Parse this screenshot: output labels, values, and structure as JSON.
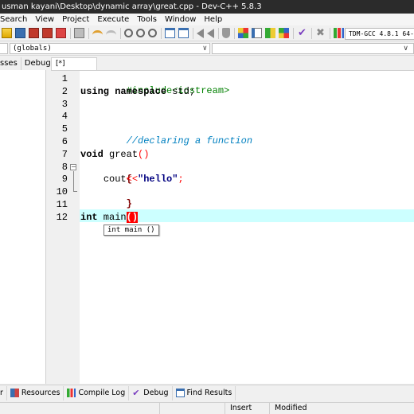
{
  "window": {
    "title": "usman kayani\\Desktop\\dynamic array\\great.cpp - Dev-C++ 5.8.3"
  },
  "menu": {
    "items": [
      "Search",
      "View",
      "Project",
      "Execute",
      "Tools",
      "Window",
      "Help"
    ]
  },
  "toolbar": {
    "compiler": "TDM-GCC 4.8.1 64-"
  },
  "scope": {
    "value": "(globals)"
  },
  "left_panel": {
    "tabs": [
      "sses",
      "Debug"
    ]
  },
  "editor": {
    "tab_label": "[*] great.cpp",
    "line_numbers": [
      "1",
      "2",
      "3",
      "4",
      "5",
      "6",
      "7",
      "8",
      "9",
      "10",
      "11",
      "12"
    ],
    "code": {
      "l1": "#include<iostream>",
      "l2_kw": "using namespace",
      "l2_rest": " std;",
      "l5": "//declaring a function",
      "l7_kw": "void",
      "l7_name": " great",
      "l7_paren": "()",
      "l8": "{",
      "l9_indent": "    ",
      "l9_id": "cout",
      "l9_op": "<<",
      "l9_str": "\"hello\"",
      "l9_end": ";",
      "l10": "}",
      "l12_kw": "int",
      "l12_name": " main",
      "l12_paren": "()"
    },
    "tooltip": "int main ()"
  },
  "bottom_tabs": [
    {
      "label": "r"
    },
    {
      "label": "Resources"
    },
    {
      "label": "Compile Log"
    },
    {
      "label": "Debug"
    },
    {
      "label": "Find Results"
    }
  ],
  "status": {
    "mode": "Insert",
    "state": "Modified"
  },
  "colors": {
    "current_line": "#ccffff",
    "title_bar": "#2b2b2b",
    "comment": "#0080c0",
    "preprocessor": "#008000"
  }
}
